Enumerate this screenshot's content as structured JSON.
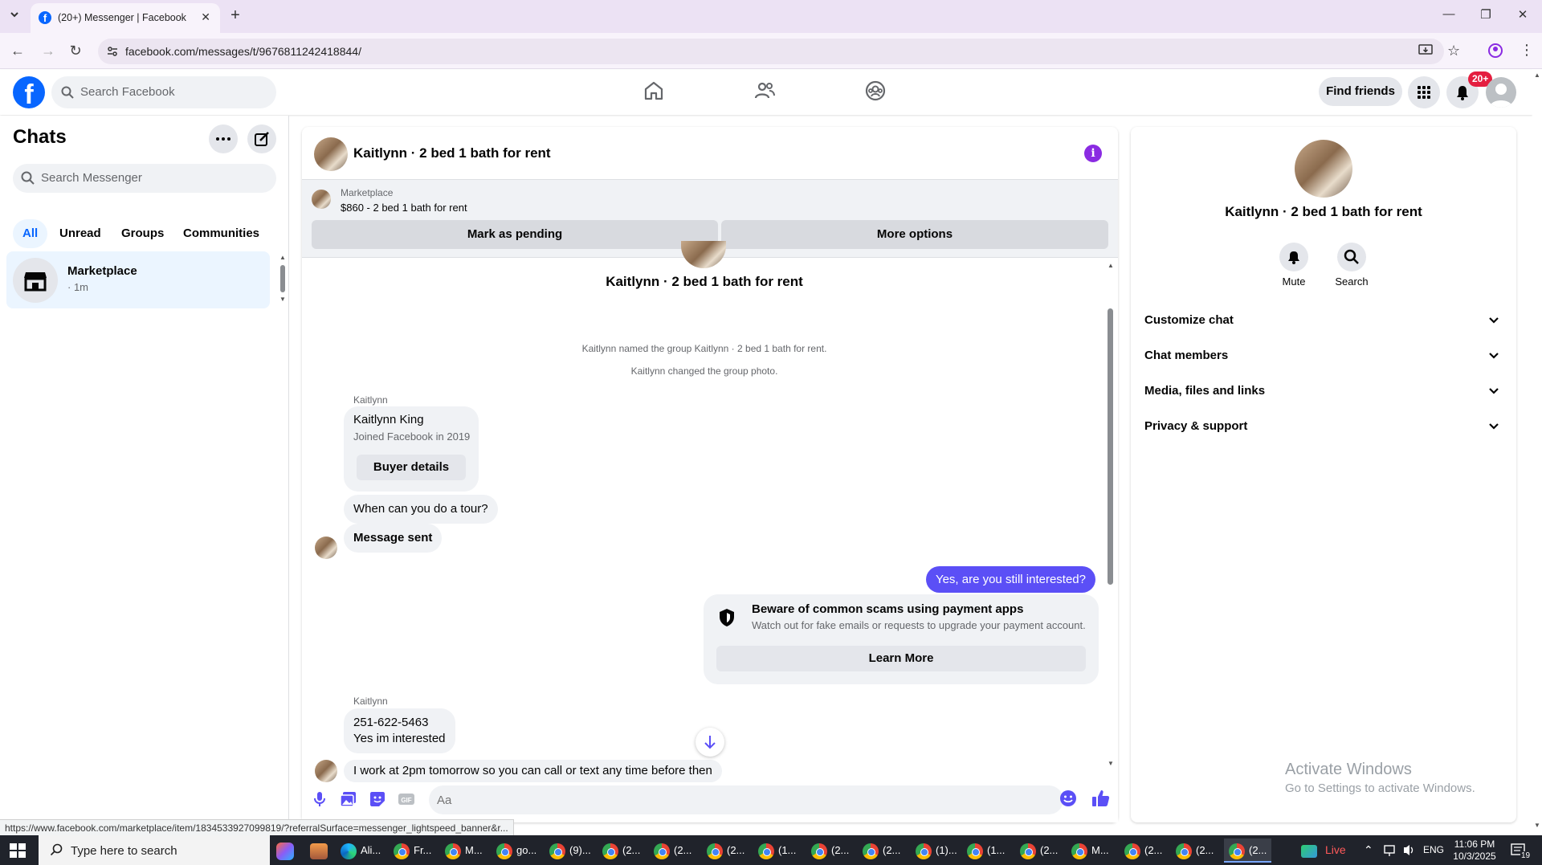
{
  "browser": {
    "tab_title": "(20+) Messenger | Facebook",
    "url": "facebook.com/messages/t/9676811242418844/",
    "status_url": "https://www.facebook.com/marketplace/item/1834533927099819/?referralSurface=messenger_lightspeed_banner&r..."
  },
  "fb_header": {
    "search_placeholder": "Search Facebook",
    "find_friends": "Find friends",
    "notification_badge": "20+",
    "brand_color": "#0866ff"
  },
  "chats_panel": {
    "title": "Chats",
    "search_placeholder": "Search Messenger",
    "filters": [
      "All",
      "Unread",
      "Groups",
      "Communities"
    ],
    "active_filter": "All",
    "items": [
      {
        "name": "Marketplace",
        "time": "· 1m"
      }
    ]
  },
  "conversation": {
    "title": "Kaitlynn · 2 bed 1 bath for rent",
    "marketplace_label": "Marketplace",
    "listing": "$860 - 2 bed 1 bath for rent",
    "mark_pending": "Mark as pending",
    "more_options": "More options",
    "system_messages": [
      "Kaitlynn named the group Kaitlynn · 2 bed 1 bath for rent.",
      "Kaitlynn changed the group photo."
    ],
    "sender_name": "Kaitlynn",
    "buyer_card": {
      "name": "Kaitlynn King",
      "joined": "Joined Facebook in 2019",
      "button": "Buyer details"
    },
    "msg_tour": "When can you do a tour?",
    "msg_sent": "Message sent",
    "msg_mine": "Yes, are you still interested?",
    "scam_warning": {
      "title": "Beware of common scams using payment apps",
      "desc": "Watch out for fake emails or requests to upgrade your payment account.",
      "button": "Learn More"
    },
    "msg_phone_line1": "251-622-5463",
    "msg_phone_line2": "Yes im interested",
    "msg_work": "I work at 2pm tomorrow so you can call or text any time before then",
    "composer_placeholder": "Aa",
    "accent_color": "#5b4ff6"
  },
  "info_panel": {
    "name": "Kaitlynn · 2 bed 1 bath for rent",
    "actions": [
      "Mute",
      "Search"
    ],
    "sections": [
      "Customize chat",
      "Chat members",
      "Media, files and links",
      "Privacy & support"
    ]
  },
  "watermark": {
    "title": "Activate Windows",
    "subtitle": "Go to Settings to activate Windows."
  },
  "taskbar": {
    "search_placeholder": "Type here to search",
    "apps": [
      "",
      "",
      "Ali...",
      "Fr...",
      "M...",
      "go...",
      "(9)...",
      "(2...",
      "(2...",
      "(2...",
      "(1...",
      "(2...",
      "(2...",
      "(1)...",
      "(1...",
      "(2...",
      "M...",
      "(2...",
      "(2...",
      "(2..."
    ],
    "live": "Live",
    "lang": "ENG",
    "time": "11:06 PM",
    "date": "10/3/2025",
    "notif_count": "19"
  }
}
